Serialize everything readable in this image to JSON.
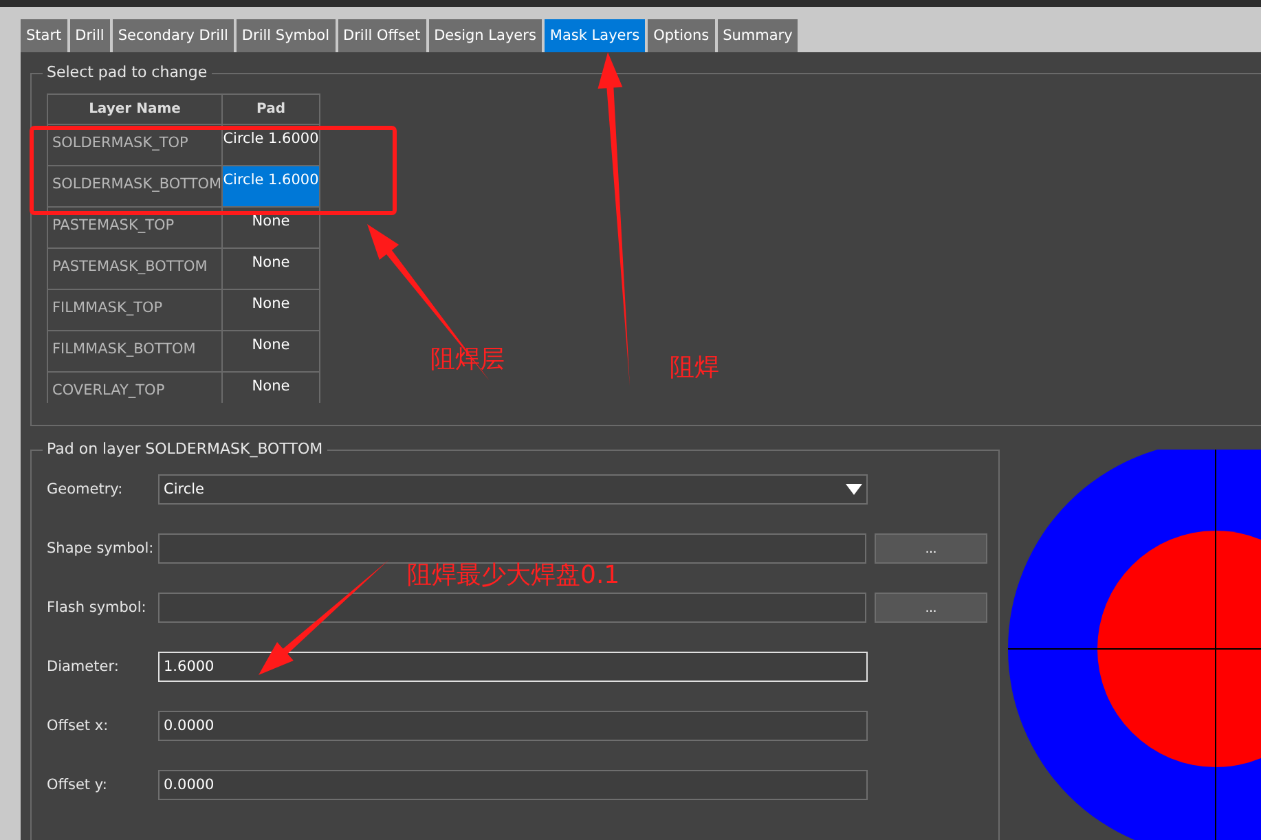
{
  "tabs": [
    {
      "label": "Start",
      "selected": false
    },
    {
      "label": "Drill",
      "selected": false
    },
    {
      "label": "Secondary Drill",
      "selected": false
    },
    {
      "label": "Drill Symbol",
      "selected": false
    },
    {
      "label": "Drill Offset",
      "selected": false
    },
    {
      "label": "Design Layers",
      "selected": false
    },
    {
      "label": "Mask Layers",
      "selected": true
    },
    {
      "label": "Options",
      "selected": false
    },
    {
      "label": "Summary",
      "selected": false
    }
  ],
  "pad_select": {
    "title": "Select pad to change",
    "columns": [
      "Layer Name",
      "Pad"
    ],
    "rows": [
      {
        "layer": "SOLDERMASK_TOP",
        "pad": "Circle 1.6000",
        "selected": false
      },
      {
        "layer": "SOLDERMASK_BOTTOM",
        "pad": "Circle 1.6000",
        "selected": true
      },
      {
        "layer": "PASTEMASK_TOP",
        "pad": "None",
        "selected": false
      },
      {
        "layer": "PASTEMASK_BOTTOM",
        "pad": "None",
        "selected": false
      },
      {
        "layer": "FILMMASK_TOP",
        "pad": "None",
        "selected": false
      },
      {
        "layer": "FILMMASK_BOTTOM",
        "pad": "None",
        "selected": false
      },
      {
        "layer": "COVERLAY_TOP",
        "pad": "None",
        "selected": false
      }
    ]
  },
  "pad_editor": {
    "title": "Pad on layer SOLDERMASK_BOTTOM",
    "fields": [
      {
        "kind": "select",
        "label": "Geometry:",
        "value": "Circle"
      },
      {
        "kind": "browse",
        "label": "Shape symbol:",
        "button": "..."
      },
      {
        "kind": "browse",
        "label": "Flash symbol:",
        "button": "..."
      },
      {
        "kind": "text",
        "label": "Diameter:",
        "value": "1.6000",
        "focused": true
      },
      {
        "kind": "text",
        "label": "Offset x:",
        "value": "0.0000",
        "focused": false
      },
      {
        "kind": "text",
        "label": "Offset y:",
        "value": "0.0000",
        "focused": false
      }
    ]
  },
  "annotations": [
    "阻焊层",
    "阻焊",
    "阻焊最少大焊盘0.1"
  ]
}
